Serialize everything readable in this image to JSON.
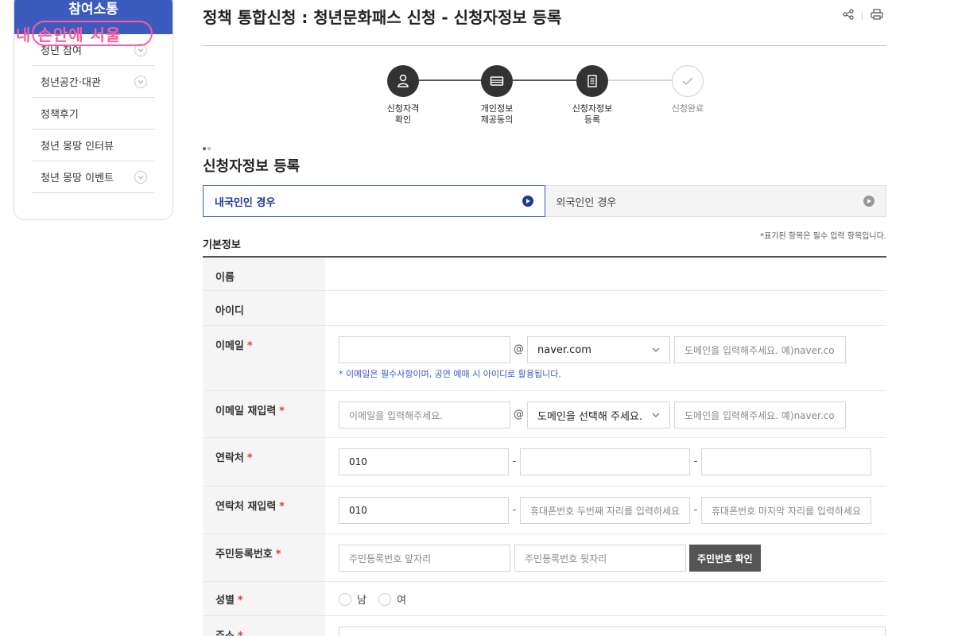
{
  "sidebar": {
    "header": "참여소통",
    "logo_text": "내 손안에 서울",
    "items": [
      {
        "label": "청년 참여",
        "expandable": true
      },
      {
        "label": "청년공간·대관",
        "expandable": true
      },
      {
        "label": "정책후기",
        "expandable": false
      },
      {
        "label": "청년 몽땅 인터뷰",
        "expandable": false
      },
      {
        "label": "청년 몽땅 이벤트",
        "expandable": true
      }
    ]
  },
  "page": {
    "title": "정책 통합신청 : 청년문화패스 신청 - 신청자정보 등록",
    "actions": [
      "share-icon",
      "print-icon"
    ]
  },
  "steps": [
    {
      "label_line1": "신청자격",
      "label_line2": "확인",
      "state": "done",
      "icon": "person-icon"
    },
    {
      "label_line1": "개인정보",
      "label_line2": "제공동의",
      "state": "done",
      "icon": "card-icon"
    },
    {
      "label_line1": "신청자정보",
      "label_line2": "등록",
      "state": "current",
      "icon": "document-icon"
    },
    {
      "label_line1": "신청완료",
      "label_line2": "",
      "state": "pending",
      "icon": "check-icon"
    }
  ],
  "section": {
    "title": "신청자정보 등록",
    "tabs": [
      {
        "label": "내국인인 경우",
        "active": true
      },
      {
        "label": "외국인인 경우",
        "active": false
      }
    ],
    "basic_title": "기본정보",
    "required_note": "*표기된 항목은 필수 입력 항목입니다."
  },
  "form": {
    "name": {
      "label": "이름"
    },
    "userid": {
      "label": "아이디"
    },
    "email": {
      "label": "이메일",
      "local_value": "",
      "at": "@",
      "domain_select": "naver.com",
      "domain_placeholder": "도메인을 입력해주세요. 예)naver.co",
      "helper": "* 이메일은 필수사항이며, 공연 예매 시 아이디로 활용됩니다."
    },
    "email_confirm": {
      "label": "이메일 재입력",
      "local_placeholder": "이메일을 입력해주세요.",
      "at": "@",
      "domain_select": "도메인을 선택해 주세요.",
      "domain_placeholder": "도메인을 입력해주세요. 예)naver.co"
    },
    "phone": {
      "label": "연락처",
      "part1": "010",
      "part2": "",
      "part3": "",
      "dash": "-"
    },
    "phone_confirm": {
      "label": "연락처 재입력",
      "part1": "010",
      "part2_placeholder": "휴대폰번호 두번째 자리를 입력하세요",
      "part3_placeholder": "휴대폰번호 마지막 자리를 입력하세요",
      "dash": "-"
    },
    "rrn": {
      "label": "주민등록번호",
      "front_placeholder": "주민등록번호 앞자리",
      "back_placeholder": "주민등록번호 뒷자리",
      "verify_button": "주민번호 확인"
    },
    "gender": {
      "label": "성별",
      "options": [
        "남",
        "여"
      ]
    },
    "address": {
      "label": "주소"
    }
  },
  "colors": {
    "brand_blue": "#3b5bbf",
    "required_red": "#e33333",
    "logo_pink": "#ff5b9c",
    "step_dark": "#333333"
  }
}
